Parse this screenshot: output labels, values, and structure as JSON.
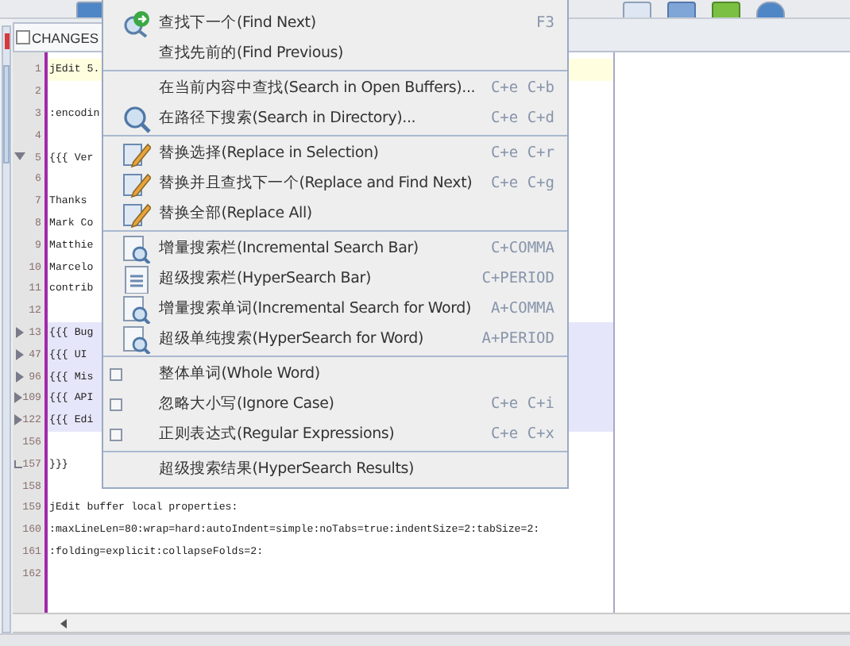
{
  "buffer_tab": {
    "title": "CHANGES",
    "selected": true
  },
  "editor": {
    "lines": [
      {
        "kind": "plain",
        "number": "1",
        "text": "jEdit 5.",
        "current": true
      },
      {
        "kind": "plain",
        "number": "2",
        "current": false
      },
      {
        "kind": "plain",
        "number": "3",
        "text": ":encodin",
        "current": false
      },
      {
        "kind": "plain",
        "number": "4",
        "current": false
      },
      {
        "kind": "open",
        "number": "5",
        "text": "{{{ Ver",
        "current": false
      },
      {
        "kind": "plain",
        "number": "6",
        "current": false
      },
      {
        "kind": "plain",
        "number": "7",
        "text": "Thanks ",
        "current": false
      },
      {
        "kind": "plain",
        "number": "8",
        "text": "Mark Co",
        "current": false
      },
      {
        "kind": "plain",
        "number": "9",
        "text": "Matthie",
        "current": false
      },
      {
        "kind": "plain",
        "number": "10",
        "text": "Marcelo",
        "current": false
      },
      {
        "kind": "plain",
        "number": "11",
        "text": "contrib",
        "current": false
      },
      {
        "kind": "plain",
        "number": "12",
        "current": false
      },
      {
        "kind": "folded",
        "number": "13",
        "text": "{{{ Bug",
        "current": false
      },
      {
        "kind": "folded",
        "number": "47",
        "text": "{{{ UI ",
        "current": false
      },
      {
        "kind": "folded",
        "number": "96",
        "text": "{{{ Mis",
        "current": false
      },
      {
        "kind": "folded",
        "number": "109",
        "text": "{{{ API",
        "current": false
      },
      {
        "kind": "folded",
        "number": "122",
        "text": "{{{ Edi",
        "current": false
      },
      {
        "kind": "plain",
        "number": "156",
        "current": false
      },
      {
        "kind": "close",
        "number": "157",
        "text": "}}}",
        "current": false
      },
      {
        "kind": "plain",
        "number": "158",
        "current": false
      },
      {
        "kind": "plain",
        "number": "159",
        "text": "jEdit buffer local properties:",
        "current": false
      },
      {
        "kind": "plain",
        "number": "160",
        "text": ":maxLineLen=80:wrap=hard:autoIndent=simple:noTabs=true:indentSize=2:tabSize=2:",
        "current": false
      },
      {
        "kind": "plain",
        "number": "161",
        "text": ":folding=explicit:collapseFolds=2:",
        "current": false
      },
      {
        "kind": "plain",
        "number": "162",
        "current": false
      }
    ]
  },
  "menu": {
    "groups": [
      [
        {
          "kind": "find-next",
          "label": "查找下一个(Find Next)",
          "shortcut": "F3"
        },
        {
          "kind": "plain",
          "label": "查找先前的(Find Previous)"
        }
      ],
      [
        {
          "kind": "plain",
          "label": "在当前内容中查找(Search in Open Buffers)...",
          "shortcut": "C+e C+b"
        },
        {
          "kind": "search",
          "label": "在路径下搜索(Search in Directory)...",
          "shortcut": "C+e C+d"
        }
      ],
      [
        {
          "kind": "replace",
          "label": "替换选择(Replace in Selection)",
          "shortcut": "C+e C+r"
        },
        {
          "kind": "replace",
          "label": "替换并且查找下一个(Replace and Find Next)",
          "shortcut": "C+e C+g"
        },
        {
          "kind": "replace",
          "label": "替换全部(Replace All)"
        }
      ],
      [
        {
          "kind": "search-bar",
          "label": "增量搜索栏(Incremental Search Bar)",
          "shortcut": "C+COMMA"
        },
        {
          "kind": "results-bar",
          "label": "超级搜索栏(HyperSearch Bar)",
          "shortcut": "C+PERIOD"
        },
        {
          "kind": "search-bar",
          "label": "增量搜索单词(Incremental Search for Word)",
          "shortcut": "A+COMMA"
        },
        {
          "kind": "search-bar",
          "label": "超级单纯搜索(HyperSearch for Word)",
          "shortcut": "A+PERIOD"
        }
      ],
      [
        {
          "kind": "checkbox",
          "checked": false,
          "label": "整体单词(Whole Word)"
        },
        {
          "kind": "checkbox",
          "checked": false,
          "label": "忽略大小写(Ignore Case)",
          "shortcut": "C+e C+i"
        },
        {
          "kind": "checkbox",
          "checked": false,
          "label": "正则表达式(Regular Expressions)",
          "shortcut": "C+e C+x"
        }
      ],
      [
        {
          "kind": "plain",
          "label": "超级搜索结果(HyperSearch Results)"
        }
      ]
    ]
  }
}
